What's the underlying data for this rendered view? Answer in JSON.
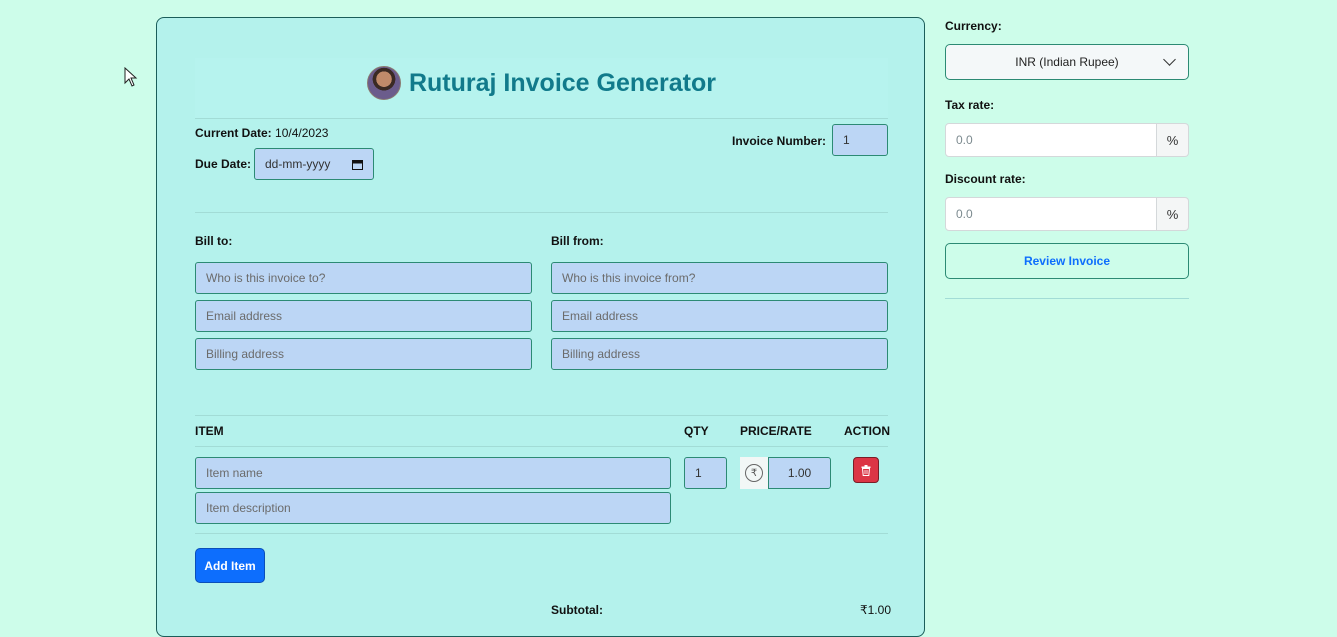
{
  "header": {
    "title": "Ruturaj Invoice Generator"
  },
  "meta": {
    "current_date_label": "Current Date:",
    "current_date_value": "10/4/2023",
    "due_date_label": "Due Date:",
    "due_date_placeholder": "dd-mm-yyyy",
    "invoice_number_label": "Invoice Number:",
    "invoice_number_value": "1"
  },
  "bill_to": {
    "label": "Bill to:",
    "name_placeholder": "Who is this invoice to?",
    "email_placeholder": "Email address",
    "address_placeholder": "Billing address"
  },
  "bill_from": {
    "label": "Bill from:",
    "name_placeholder": "Who is this invoice from?",
    "email_placeholder": "Email address",
    "address_placeholder": "Billing address"
  },
  "items_table": {
    "headers": [
      "ITEM",
      "QTY",
      "PRICE/RATE",
      "ACTION"
    ],
    "rows": [
      {
        "name_placeholder": "Item name",
        "description_placeholder": "Item description",
        "qty": "1",
        "currency_symbol": "₹",
        "price": "1.00"
      }
    ]
  },
  "add_item_label": "Add Item",
  "totals": {
    "subtotal_label": "Subtotal:",
    "subtotal_value": "₹1.00"
  },
  "side_panel": {
    "currency_label": "Currency:",
    "currency_selected": "INR (Indian Rupee)",
    "tax_label": "Tax rate:",
    "tax_placeholder": "0.0",
    "discount_label": "Discount rate:",
    "discount_placeholder": "0.0",
    "percent_symbol": "%",
    "review_label": "Review Invoice"
  },
  "colors": {
    "page_bg": "#cdfdea",
    "card_bg": "#b4f2ec",
    "title": "#117a8b",
    "input_bg": "#bcd6f5",
    "primary": "#0d6efd",
    "danger": "#dc3545"
  },
  "icons": {
    "delete": "trash-icon",
    "calendar": "calendar-icon",
    "dropdown": "chevron-down-icon",
    "cursor": "mouse-pointer-icon"
  }
}
